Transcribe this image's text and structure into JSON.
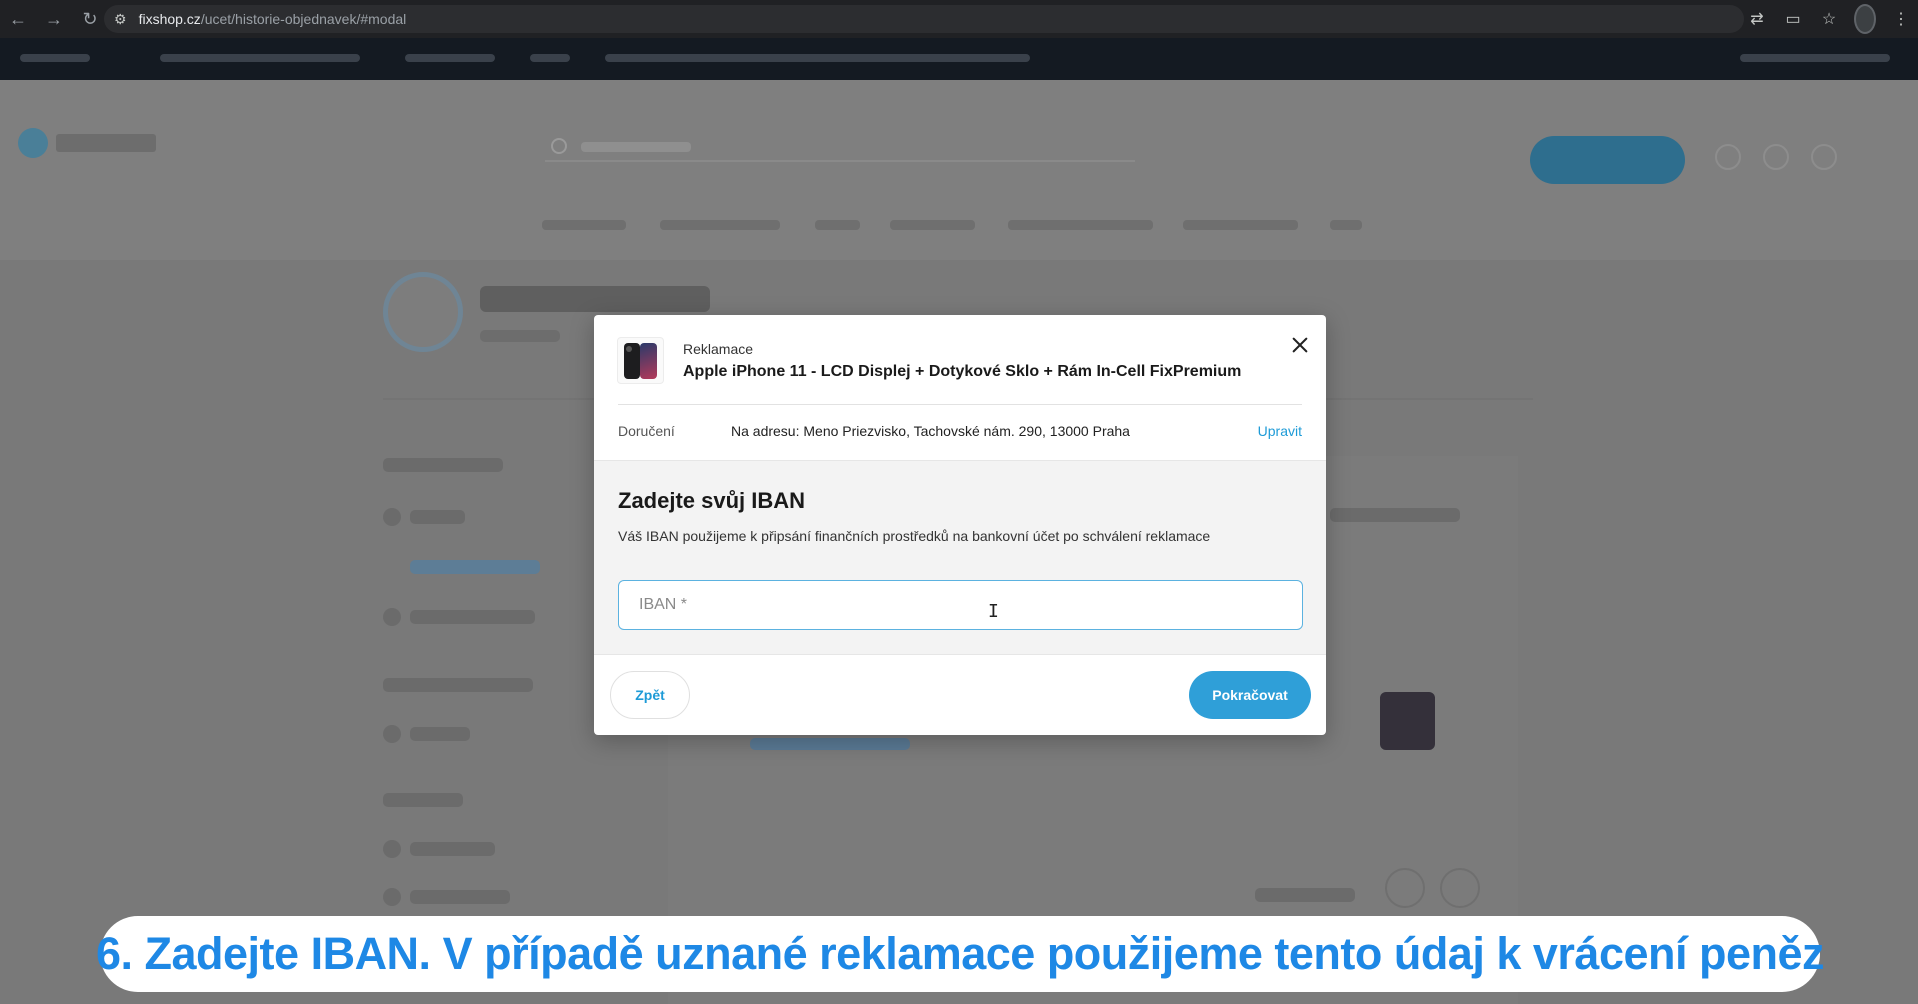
{
  "browser": {
    "url_host": "fixshop.cz",
    "url_path": "/ucet/historie-objednavek/#modal"
  },
  "modal": {
    "kicker": "Reklamace",
    "product_title": "Apple iPhone 11 - LCD Displej + Dotykové Sklo + Rám In-Cell FixPremium",
    "delivery_label": "Doručení",
    "delivery_value": "Na adresu: Meno Priezvisko, Tachovské nám. 290, 13000 Praha",
    "delivery_edit": "Upravit",
    "section_title": "Zadejte svůj IBAN",
    "section_desc": "Váš IBAN použijeme k připsání finančních prostředků na bankovní účet po schválení reklamace",
    "iban_placeholder": "IBAN *",
    "iban_value": "",
    "back_label": "Zpět",
    "continue_label": "Pokračovat"
  },
  "caption": "6. Zadejte IBAN. V případě uznané reklamace použijeme tento údaj k vrácení peněz",
  "icons": {
    "back": "arrow-left-icon",
    "forward": "arrow-right-icon",
    "reload": "reload-icon",
    "site_info": "site-settings-icon",
    "translate": "translate-icon",
    "card": "payment-card-icon",
    "bookmark": "star-icon",
    "close": "close-icon",
    "menu": "more-vertical-icon"
  },
  "colors": {
    "accent": "#2f9fd8",
    "link": "#1e9bd7",
    "caption_text": "#1e88e5"
  }
}
